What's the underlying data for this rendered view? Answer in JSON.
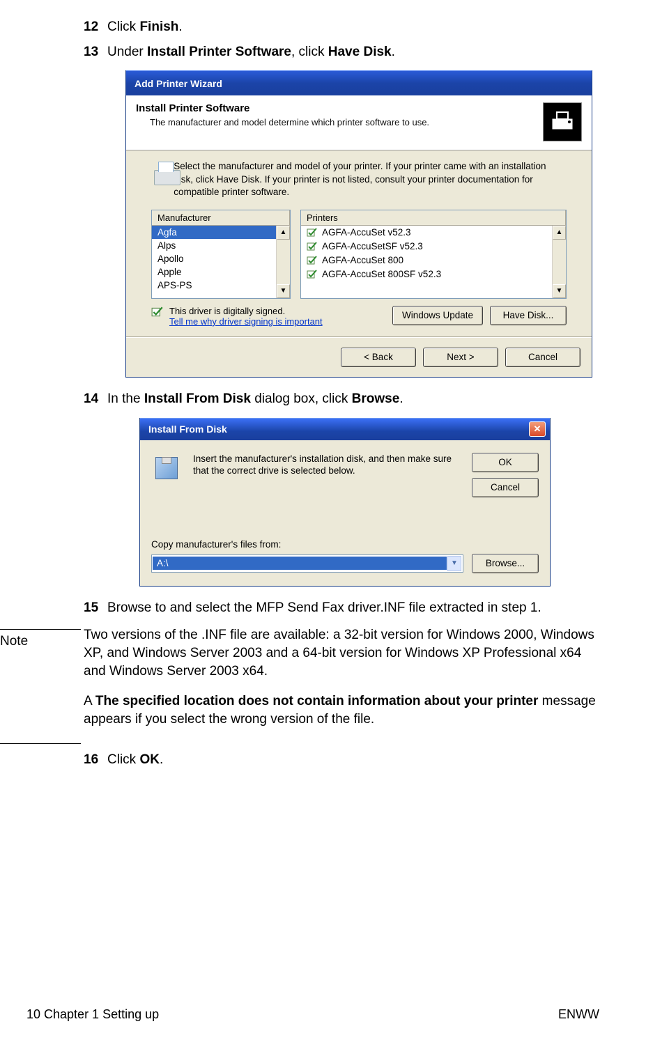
{
  "steps": {
    "s12": {
      "num": "12",
      "pre": "Click ",
      "b1": "Finish",
      "post": "."
    },
    "s13": {
      "num": "13",
      "pre": "Under ",
      "b1": "Install Printer Software",
      "mid": ", click ",
      "b2": "Have Disk",
      "post": "."
    },
    "s14": {
      "num": "14",
      "pre": "In the ",
      "b1": "Install From Disk",
      "mid": " dialog box, click ",
      "b2": "Browse",
      "post": "."
    },
    "s15": {
      "num": "15",
      "body": "Browse to and select the MFP Send Fax driver.INF file extracted in step 1."
    },
    "s16": {
      "num": "16",
      "pre": "Click ",
      "b1": "OK",
      "post": "."
    }
  },
  "wizard": {
    "title": "Add Printer Wizard",
    "headerTitle": "Install Printer Software",
    "headerSub": "The manufacturer and model determine which printer software to use.",
    "infoText": "Select the manufacturer and model of your printer. If your printer came with an installation disk, click Have Disk. If your printer is not listed, consult your printer documentation for compatible printer software.",
    "mfgHeader": "Manufacturer",
    "prnHeader": "Printers",
    "manufacturers": [
      "Agfa",
      "Alps",
      "Apollo",
      "Apple",
      "APS-PS"
    ],
    "printers": [
      "AGFA-AccuSet v52.3",
      "AGFA-AccuSetSF v52.3",
      "AGFA-AccuSet 800",
      "AGFA-AccuSet 800SF v52.3"
    ],
    "signedText": "This driver is digitally signed.",
    "signedLink": "Tell me why driver signing is important",
    "btnWindowsUpdate": "Windows Update",
    "btnHaveDisk": "Have Disk...",
    "btnBack": "< Back",
    "btnNext": "Next >",
    "btnCancel": "Cancel"
  },
  "installFromDisk": {
    "title": "Install From Disk",
    "message": "Insert the manufacturer's installation disk, and then make sure that the correct drive is selected below.",
    "btnOK": "OK",
    "btnCancel": "Cancel",
    "copyLabel": "Copy manufacturer's files from:",
    "fieldValue": "A:\\",
    "btnBrowse": "Browse..."
  },
  "note": {
    "label": "Note",
    "p1": "Two versions of the .INF file are available: a 32-bit version for Windows 2000, Windows XP, and Windows Server 2003 and a 64-bit version for Windows XP Professional x64 and Windows Server 2003 x64.",
    "p2a": "A ",
    "p2b": "The specified location does not contain information about your printer",
    "p2c": " message appears if you select the wrong version of the file."
  },
  "footer": {
    "left": "10  Chapter 1 Setting up",
    "right": "ENWW"
  }
}
